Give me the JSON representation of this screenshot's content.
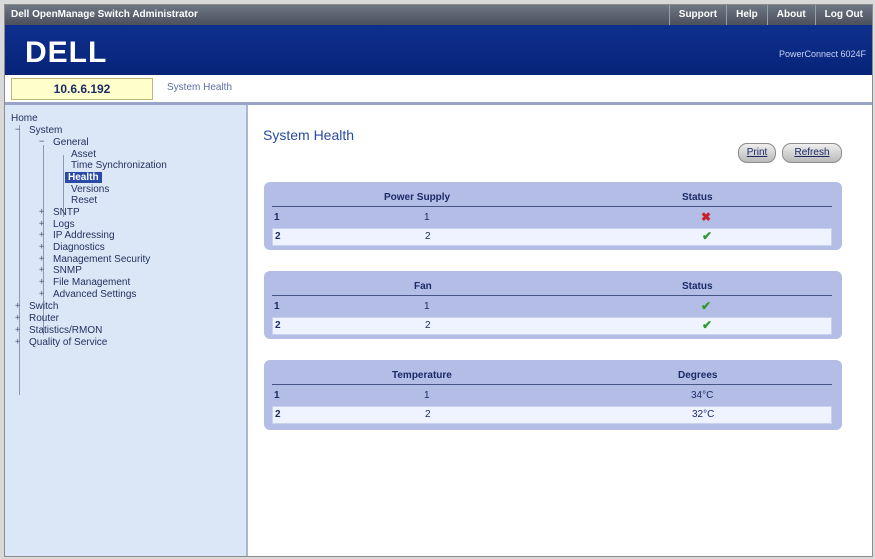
{
  "topbar": {
    "title": "Dell OpenManage Switch Administrator",
    "menu": [
      "Support",
      "Help",
      "About",
      "Log Out"
    ]
  },
  "header": {
    "logo": "DELL",
    "product": "PowerConnect 6024F"
  },
  "address": {
    "ip": "10.6.6.192",
    "breadcrumb": "System Health"
  },
  "tree": {
    "home": "Home",
    "system": "System",
    "general": "General",
    "asset": "Asset",
    "time_sync": "Time Synchronization",
    "health": "Health",
    "versions": "Versions",
    "reset": "Reset",
    "sntp": "SNTP",
    "logs": "Logs",
    "ip_addressing": "IP Addressing",
    "diagnostics": "Diagnostics",
    "mgmt_security": "Management Security",
    "snmp": "SNMP",
    "file_mgmt": "File Management",
    "advanced": "Advanced Settings",
    "switch": "Switch",
    "router": "Router",
    "statistics": "Statistics/RMON",
    "qos": "Quality of Service"
  },
  "main": {
    "title": "System Health",
    "print_label": "Print",
    "refresh_label": "Refresh"
  },
  "power_supply": {
    "col1": "Power Supply",
    "col2": "Status",
    "rows": [
      {
        "idx": "1",
        "unit": "1",
        "status": "✖",
        "status_icon": "error-x-icon"
      },
      {
        "idx": "2",
        "unit": "2",
        "status": "✔",
        "status_icon": "ok-check-icon"
      }
    ]
  },
  "fan": {
    "col1": "Fan",
    "col2": "Status",
    "rows": [
      {
        "idx": "1",
        "unit": "1",
        "status": "✔",
        "status_icon": "ok-check-icon"
      },
      {
        "idx": "2",
        "unit": "2",
        "status": "✔",
        "status_icon": "ok-check-icon"
      }
    ]
  },
  "temperature": {
    "col1": "Temperature",
    "col2": "Degrees",
    "rows": [
      {
        "idx": "1",
        "unit": "1",
        "degrees": "34°C"
      },
      {
        "idx": "2",
        "unit": "2",
        "degrees": "32°C"
      }
    ]
  },
  "colors": {
    "accent": "#0f2f8e",
    "panel": "#b3bde6",
    "ok": "#2d9a2d",
    "error": "#c8202a"
  }
}
